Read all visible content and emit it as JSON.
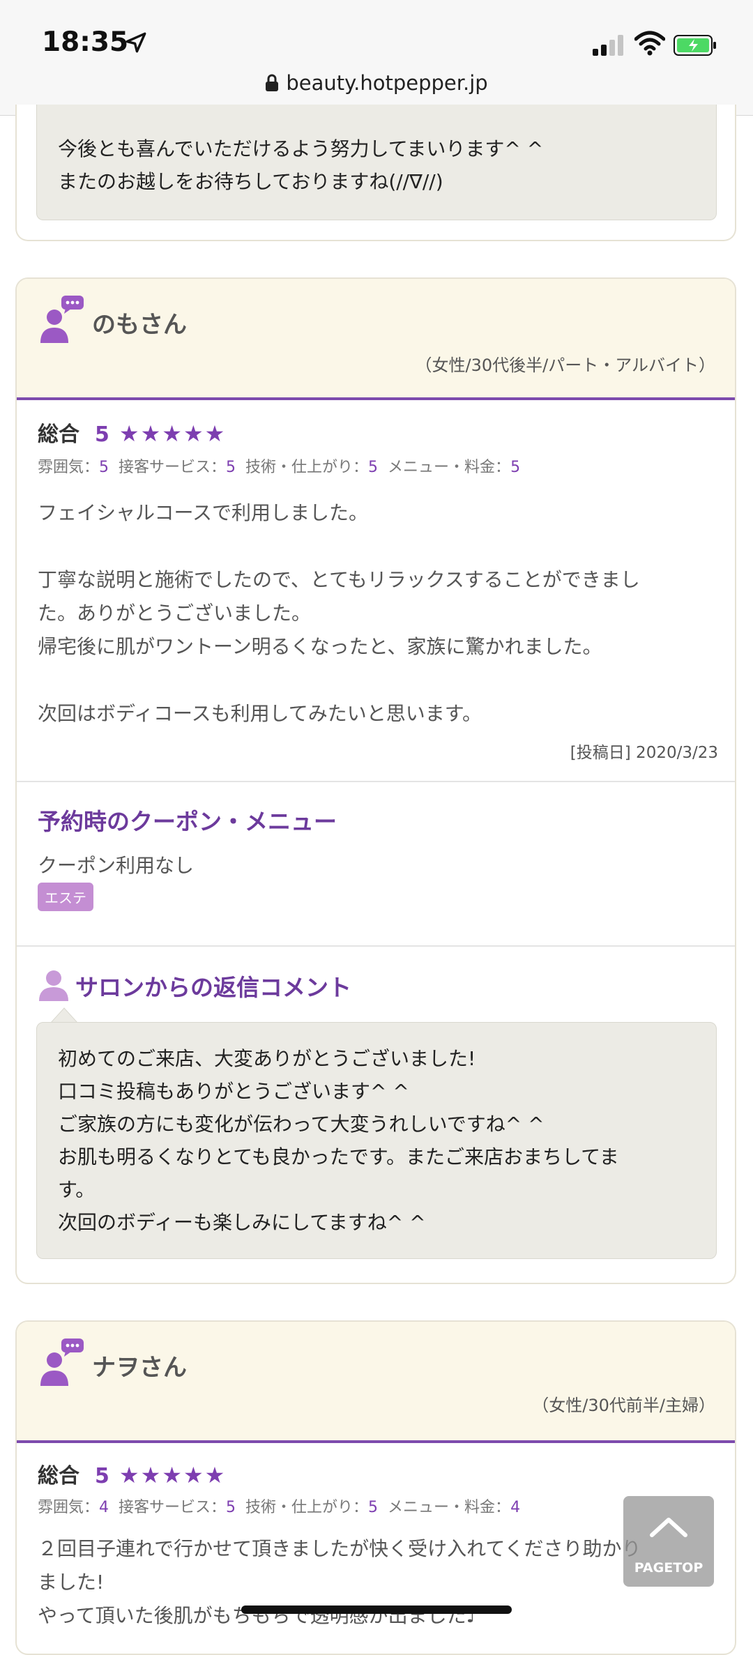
{
  "status_bar": {
    "time": "18:35",
    "url": "beauty.hotpepper.jp"
  },
  "prev_reply": {
    "lines": [
      "今後とも喜んでいただけるよう努力してまいります^ ^",
      "またのお越しをお待ちしておりますね(//∇//)"
    ]
  },
  "reviews": [
    {
      "name": "のもさん",
      "meta": "（女性/30代後半/パート・アルバイト）",
      "overall_label": "総合",
      "overall": "5",
      "stars": "★★★★★",
      "sub": [
        {
          "label": "雰囲気：",
          "value": "5"
        },
        {
          "label": "接客サービス：",
          "value": "5"
        },
        {
          "label": "技術・仕上がり：",
          "value": "5"
        },
        {
          "label": "メニュー・料金：",
          "value": "5"
        }
      ],
      "body": [
        "フェイシャルコースで利用しました。",
        "",
        "丁寧な説明と施術でしたので、とてもリラックスすることができまし",
        "た。ありがとうございました。",
        "帰宅後に肌がワントーン明るくなったと、家族に驚かれました。",
        "",
        "次回はボディコースも利用してみたいと思います。"
      ],
      "post_date": "[投稿日] 2020/3/23",
      "coupon_title": "予約時のクーポン・メニュー",
      "coupon_text": "クーポン利用なし",
      "tag": "エステ",
      "reply_title": "サロンからの返信コメント",
      "reply": [
        "初めてのご来店、大変ありがとうございました!",
        "口コミ投稿もありがとうございます^ ^",
        "ご家族の方にも変化が伝わって大変うれしいですね^ ^",
        "お肌も明るくなりとても良かったです。またご来店おまちしてま",
        "す。",
        "次回のボディーも楽しみにしてますね^ ^"
      ]
    },
    {
      "name": "ナヲさん",
      "meta": "（女性/30代前半/主婦）",
      "overall_label": "総合",
      "overall": "5",
      "stars": "★★★★★",
      "sub": [
        {
          "label": "雰囲気：",
          "value": "4"
        },
        {
          "label": "接客サービス：",
          "value": "5"
        },
        {
          "label": "技術・仕上がり：",
          "value": "5"
        },
        {
          "label": "メニュー・料金：",
          "value": "4"
        }
      ],
      "body": [
        "２回目子連れで行かせて頂きましたが快く受け入れてくださり助かり",
        "ました!",
        "やって頂いた後肌がもちもちで透明感が出ました♪"
      ]
    }
  ],
  "pagetop_label": "PAGETOP",
  "colors": {
    "accent": "#7d4bad",
    "header_bg": "#fbf7e8",
    "reply_bg": "#ecebe5"
  },
  "icons": [
    "location-arrow-icon",
    "signal-icon",
    "wifi-icon",
    "battery-icon",
    "lock-icon",
    "reviewer-icon",
    "salon-icon",
    "chevron-up-icon"
  ]
}
